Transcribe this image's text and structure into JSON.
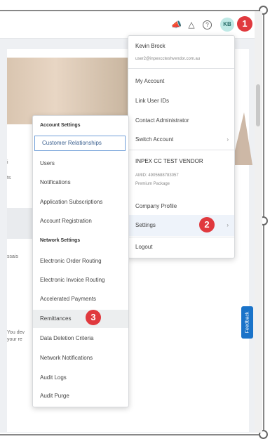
{
  "header": {
    "avatar_initials": "KB",
    "icons": [
      "megaphone-icon",
      "bell-icon",
      "help-icon"
    ]
  },
  "user_menu": {
    "name": "Kevin Brock",
    "email": "user2@inpexccteshvendor.com.au",
    "items": [
      "My Account",
      "Link User IDs",
      "Contact Administrator",
      "Switch Account"
    ],
    "org_name": "INPEX CC TEST VENDOR",
    "abn": "AMID: 4905688783057",
    "package": "Premium Package",
    "company_profile": "Company Profile",
    "settings": "Settings",
    "logout": "Logout"
  },
  "settings_menu": {
    "account_header": "Account Settings",
    "account_items": [
      "Customer Relationships",
      "Users",
      "Notifications",
      "Application Subscriptions",
      "Account Registration"
    ],
    "network_header": "Network Settings",
    "network_items": [
      "Electronic Order Routing",
      "Electronic Invoice Routing",
      "Accelerated Payments",
      "Remittances",
      "Data Deletion Criteria",
      "Network Notifications",
      "Audit Logs",
      "Audit Purge"
    ]
  },
  "background": {
    "side_text_1": "i",
    "side_text_2": "ts",
    "side_text_3": "ssais",
    "side_text_4": "You dev",
    "side_text_5": "your re"
  },
  "feedback_label": "Feedback",
  "annotations": {
    "step1": "1",
    "step2": "2",
    "step3": "3"
  }
}
